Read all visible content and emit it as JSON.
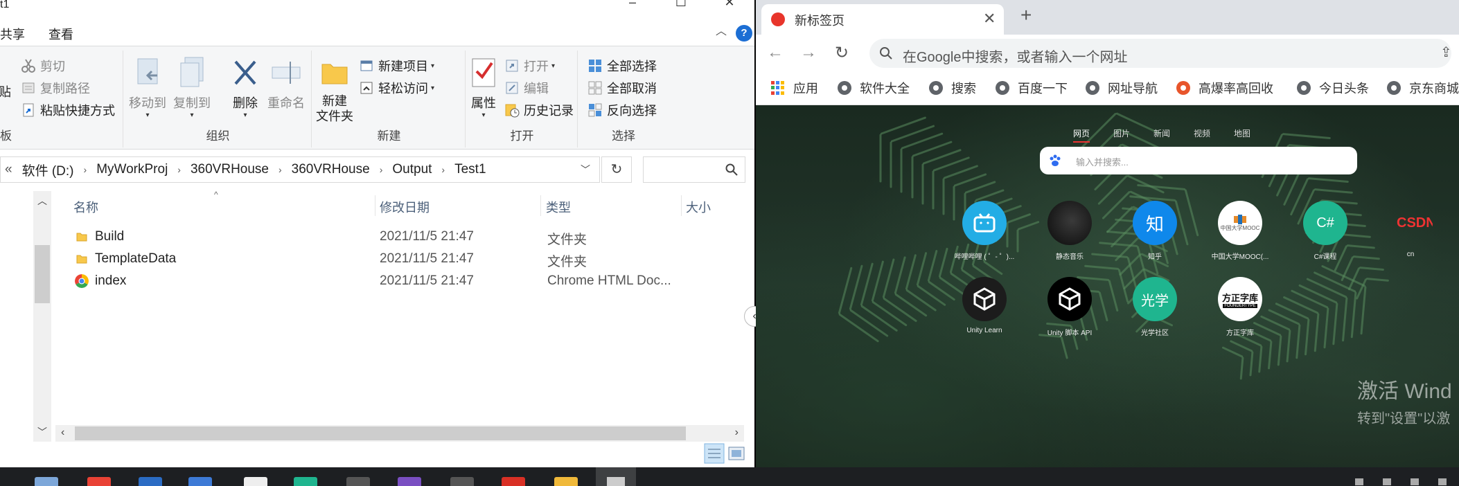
{
  "explorer": {
    "title": "t1",
    "menu_tabs": [
      "共享",
      "查看"
    ],
    "ribbon": {
      "clipboard": {
        "label": "板",
        "paste": "贴",
        "cut": "剪切",
        "copy_path": "复制路径",
        "paste_shortcut": "粘贴快捷方式"
      },
      "organize": {
        "label": "组织",
        "move_to": "移动到",
        "copy_to": "复制到",
        "delete": "删除",
        "rename": "重命名"
      },
      "new": {
        "label": "新建",
        "new_folder_line1": "新建",
        "new_folder_line2": "文件夹",
        "new_item": "新建项目",
        "easy_access": "轻松访问"
      },
      "open": {
        "label": "打开",
        "properties": "属性",
        "open": "打开",
        "edit": "编辑",
        "history": "历史记录"
      },
      "select": {
        "label": "选择",
        "select_all": "全部选择",
        "select_none": "全部取消",
        "invert": "反向选择"
      }
    },
    "address": {
      "overflow": "«",
      "crumbs": [
        "软件 (D:)",
        "MyWorkProj",
        "360VRHouse",
        "360VRHouse",
        "Output",
        "Test1"
      ]
    },
    "columns": {
      "name": "名称",
      "date": "修改日期",
      "type": "类型",
      "size": "大小"
    },
    "files": [
      {
        "name": "Build",
        "date": "2021/11/5 21:47",
        "type": "文件夹",
        "kind": "folder"
      },
      {
        "name": "TemplateData",
        "date": "2021/11/5 21:47",
        "type": "文件夹",
        "kind": "folder"
      },
      {
        "name": "index",
        "date": "2021/11/5 21:47",
        "type": "Chrome HTML Doc...",
        "kind": "chrome"
      }
    ]
  },
  "browser": {
    "tab_title": "新标签页",
    "omnibox_placeholder": "在Google中搜索，或者输入一个网址",
    "bookmarks": [
      "应用",
      "软件大全",
      "搜索",
      "百度一下",
      "网址导航",
      "高爆率高回收",
      "今日头条",
      "京东商城"
    ],
    "search_tabs": [
      "网页",
      "图片",
      "新闻",
      "视频",
      "地图"
    ],
    "search_placeholder": "输入并搜索...",
    "sites": [
      {
        "label": "哔哩哔哩 ( ゜- ゜)...",
        "icon": "bilibili-icon",
        "color": "#23ade5",
        "glyph": ""
      },
      {
        "label": "静态音乐",
        "icon": "music-avatar-icon",
        "color": "#111111",
        "glyph": ""
      },
      {
        "label": "知乎",
        "icon": "zhihu-icon",
        "color": "#0f88eb",
        "glyph": "知"
      },
      {
        "label": "中国大学MOOC(...",
        "icon": "mooc-icon",
        "color": "#ffffff",
        "glyph": ""
      },
      {
        "label": "C#课程",
        "icon": "csharp-icon",
        "color": "#1fb58f",
        "glyph": "C#"
      },
      {
        "label": "cn",
        "icon": "csdn-icon",
        "color": "transparent",
        "glyph": "CSDN"
      },
      {
        "label": "Unity Learn",
        "icon": "unity-icon",
        "color": "#222222",
        "glyph": ""
      },
      {
        "label": "Unity 脚本 API",
        "icon": "unity-api-icon",
        "color": "#000000",
        "glyph": ""
      },
      {
        "label": "光学社区",
        "icon": "optics-icon",
        "color": "#1fb58f",
        "glyph": "光学"
      },
      {
        "label": "方正字库",
        "icon": "foundertype-icon",
        "color": "#ffffff",
        "glyph": "方正字库"
      }
    ],
    "foundertype_sub": "FOUNDERTYPE",
    "mooc_text": "中国大学MOOC",
    "activate_line1": "激活 Wind",
    "activate_line2": "转到\"设置\"以激"
  }
}
